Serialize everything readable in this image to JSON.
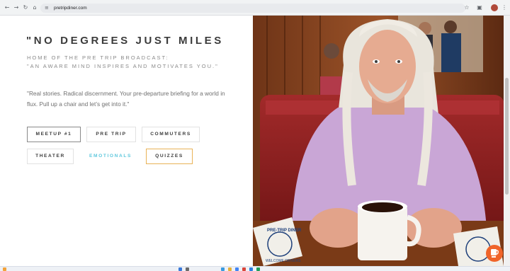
{
  "browser": {
    "url": "pretripdiner.com"
  },
  "hero": {
    "headline": "\"NO DEGREES JUST MILES",
    "subtitle_line1": "HOME OF THE PRE TRIP BROADCAST:",
    "subtitle_line2": "\"AN AWARE MIND INSPIRES AND MOTIVATES YOU.\"",
    "paragraph": "\"Real stories. Radical discernment. Your pre-departure briefing for a world in flux. Pull up a chair and let’s get into it.\""
  },
  "nav_buttons": [
    {
      "label": "MEETUP #1",
      "style": "active"
    },
    {
      "label": "PRE TRIP",
      "style": "default"
    },
    {
      "label": "COMMUTERS",
      "style": "default"
    },
    {
      "label": "THEATER",
      "style": "default"
    },
    {
      "label": "EMOTIONALS",
      "style": "flat"
    },
    {
      "label": "QUIZZES",
      "style": "gold"
    }
  ],
  "photo": {
    "napkin_text_1": "PRE-TRIP DINER",
    "napkin_text_2": "WELCOME DRIVERS"
  },
  "colors": {
    "accent_cyan": "#5fc8dd",
    "accent_gold": "#e9b257",
    "chat_orange": "#f0642a"
  },
  "icons": [
    "back-icon",
    "forward-icon",
    "reload-icon",
    "home-icon",
    "site-settings-icon",
    "bookmark-star-icon",
    "extensions-icon",
    "chat-icon"
  ]
}
